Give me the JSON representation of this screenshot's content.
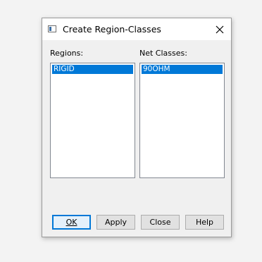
{
  "dialog": {
    "title": "Create Region-Classes",
    "regions_label": "Regions:",
    "netclasses_label": "Net Classes:",
    "regions_items": [
      "RIGID"
    ],
    "netclasses_items": [
      "90OHM"
    ],
    "buttons": {
      "ok": "OK",
      "apply": "Apply",
      "close": "Close",
      "help": "Help"
    }
  },
  "icons": {
    "app": "app-window-icon",
    "close": "close-icon"
  },
  "colors": {
    "selection": "#0078d7",
    "default_button_border": "#0078d7"
  }
}
